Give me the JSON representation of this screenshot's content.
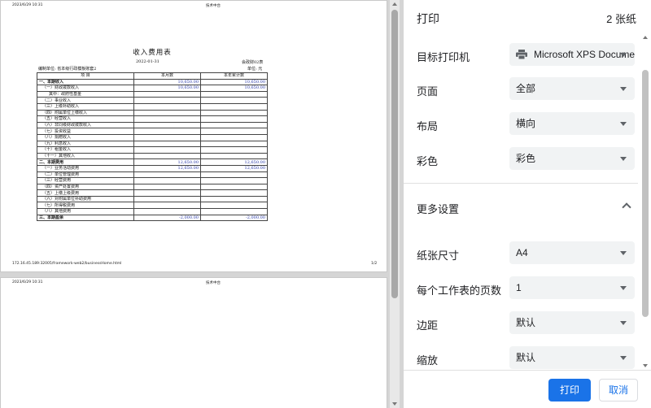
{
  "preview": {
    "page1": {
      "header_left": "2023/6/29 10:31",
      "header_center": "技术中台",
      "report": {
        "title": "收入费用表",
        "date": "2022-01-31",
        "form_code": "会政财02表",
        "unit_label": "编制单位: 省本级行政模板账套2",
        "currency_unit": "单位: 元",
        "columns": [
          "项 目",
          "本月数",
          "本年累计数"
        ],
        "rows": [
          {
            "item": "一、本期收入",
            "month": "10,650.00",
            "year": "10,650.00"
          },
          {
            "item": "（一）财政拨款收入",
            "month": "10,650.00",
            "year": "10,650.00"
          },
          {
            "item": "其中：政府性基金",
            "month": "",
            "year": ""
          },
          {
            "item": "（二）事业收入",
            "month": "",
            "year": ""
          },
          {
            "item": "（三）上级补助收入",
            "month": "",
            "year": ""
          },
          {
            "item": "（四）附属单位上缴收入",
            "month": "",
            "year": ""
          },
          {
            "item": "（五）经营收入",
            "month": "",
            "year": ""
          },
          {
            "item": "（六）非同级财政拨款收入",
            "month": "",
            "year": ""
          },
          {
            "item": "（七）投资收益",
            "month": "",
            "year": ""
          },
          {
            "item": "（八）捐赠收入",
            "month": "",
            "year": ""
          },
          {
            "item": "（九）利息收入",
            "month": "",
            "year": ""
          },
          {
            "item": "（十）租金收入",
            "month": "",
            "year": ""
          },
          {
            "item": "（十一）其他收入",
            "month": "",
            "year": ""
          },
          {
            "item": "二、本期费用",
            "month": "12,650.00",
            "year": "12,650.00"
          },
          {
            "item": "（一）业务活动费用",
            "month": "12,650.00",
            "year": "12,650.00"
          },
          {
            "item": "（二）单位管理费用",
            "month": "",
            "year": ""
          },
          {
            "item": "（三）经营费用",
            "month": "",
            "year": ""
          },
          {
            "item": "（四）资产处置费用",
            "month": "",
            "year": ""
          },
          {
            "item": "（五）上缴上级费用",
            "month": "",
            "year": ""
          },
          {
            "item": "（六）对附属单位补助费用",
            "month": "",
            "year": ""
          },
          {
            "item": "（七）所得税费用",
            "month": "",
            "year": ""
          },
          {
            "item": "（八）其他费用",
            "month": "",
            "year": ""
          },
          {
            "item": "三、本期盈余",
            "month": "-2,000.00",
            "year": "-2,000.00"
          }
        ]
      },
      "footer_url": "172.16.45.189:32005/framework-web2/businessHome.html",
      "footer_page": "1/2"
    },
    "page2": {
      "header_left": "2023/6/29 10:31",
      "header_center": "技术中台"
    }
  },
  "settings": {
    "title": "打印",
    "sheet_count": "2 张纸",
    "destination": {
      "label": "目标打印机",
      "value": "Microsoft XPS Document Writer"
    },
    "pages": {
      "label": "页面",
      "value": "全部"
    },
    "layout": {
      "label": "布局",
      "value": "横向"
    },
    "color": {
      "label": "彩色",
      "value": "彩色"
    },
    "more_settings": {
      "label": "更多设置"
    },
    "paper_size": {
      "label": "纸张尺寸",
      "value": "A4"
    },
    "pages_per_sheet": {
      "label": "每个工作表的页数",
      "value": "1"
    },
    "margins": {
      "label": "边距",
      "value": "默认"
    },
    "scale": {
      "label": "缩放",
      "value": "默认"
    },
    "print_button": "打印",
    "cancel_button": "取消"
  },
  "colors": {
    "accent": "#1a73e8",
    "report_numbers": "#2a3aa8"
  }
}
